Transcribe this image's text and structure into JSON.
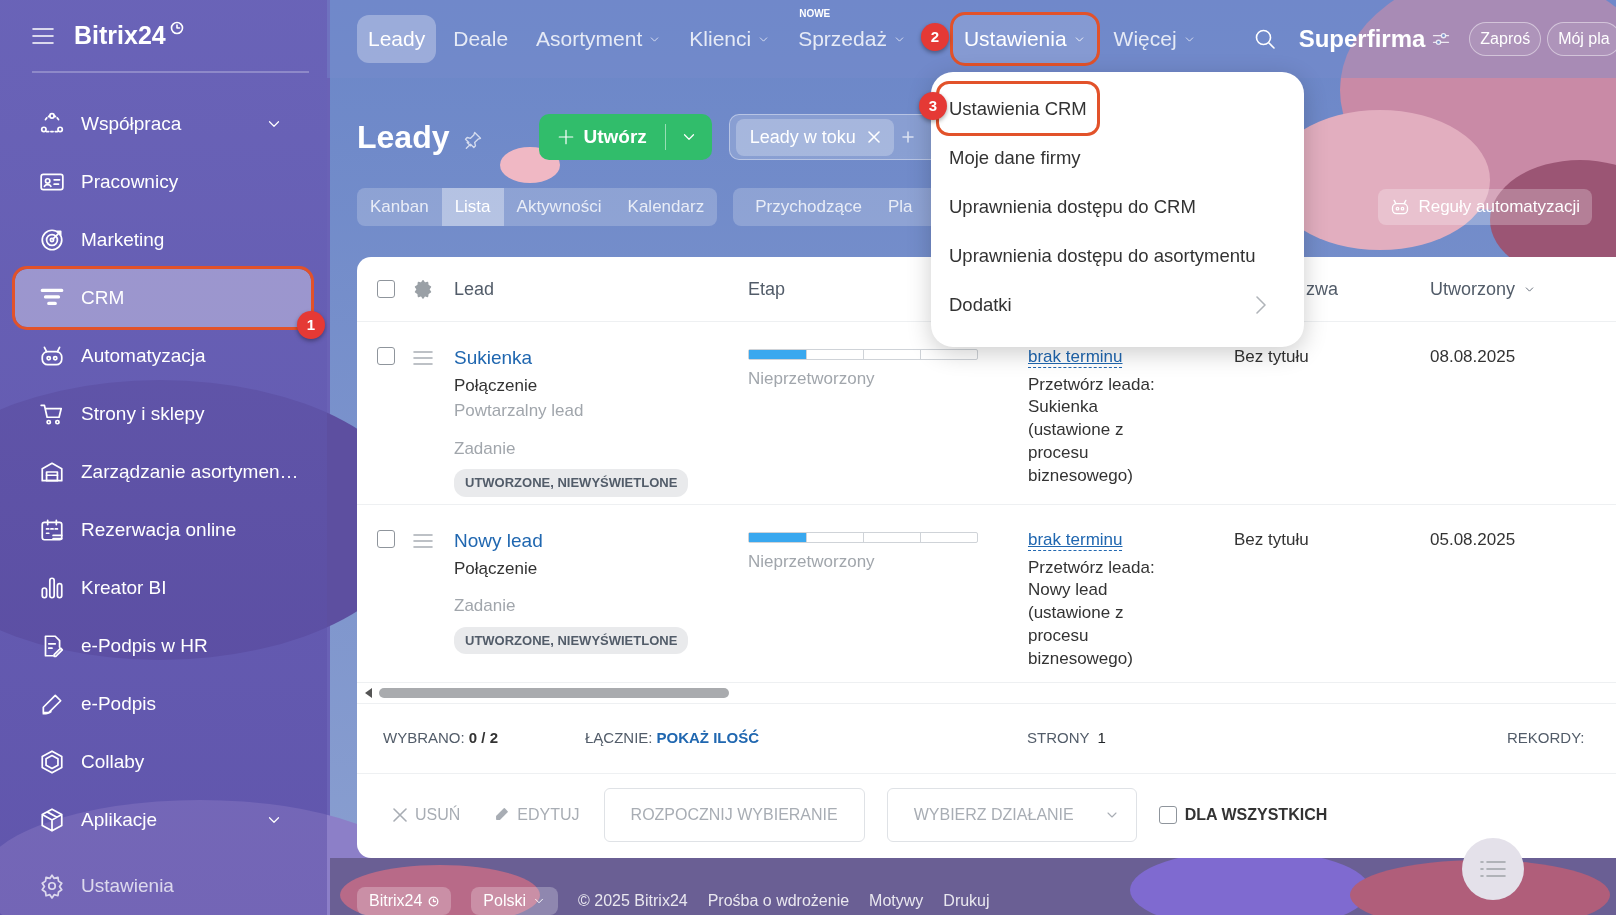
{
  "sidebar": {
    "logo": "Bitrix24",
    "items": [
      {
        "label": "Współpraca",
        "kind": "group",
        "selected": false
      },
      {
        "label": "Pracownicy",
        "kind": "link",
        "selected": false
      },
      {
        "label": "Marketing",
        "kind": "link",
        "selected": false
      },
      {
        "label": "CRM",
        "kind": "link",
        "selected": true,
        "callout": "1"
      },
      {
        "label": "Automatyzacja",
        "kind": "link",
        "selected": false
      },
      {
        "label": "Strony i sklepy",
        "kind": "link",
        "selected": false
      },
      {
        "label": "Zarządzanie asortymen…",
        "kind": "link",
        "selected": false
      },
      {
        "label": "Rezerwacja online",
        "kind": "link",
        "selected": false
      },
      {
        "label": "Kreator BI",
        "kind": "link",
        "selected": false
      },
      {
        "label": "e-Podpis w HR",
        "kind": "link",
        "selected": false
      },
      {
        "label": "e-Podpis",
        "kind": "link",
        "selected": false
      },
      {
        "label": "Collaby",
        "kind": "link",
        "selected": false
      },
      {
        "label": "Aplikacje",
        "kind": "group",
        "selected": false
      }
    ],
    "settings": "Ustawienia"
  },
  "top_nav": {
    "items": [
      {
        "label": "Leady",
        "kind": "link",
        "selected": true
      },
      {
        "label": "Deale",
        "kind": "link",
        "selected": false
      },
      {
        "label": "Asortyment",
        "kind": "menu",
        "selected": false
      },
      {
        "label": "Klienci",
        "kind": "menu",
        "selected": false
      },
      {
        "label": "Sprzedaż",
        "kind": "menu",
        "selected": false,
        "badge": "NOWE"
      },
      {
        "label": "Ustawienia",
        "kind": "menu",
        "selected": false,
        "callout": "2"
      },
      {
        "label": "Więcej",
        "kind": "menu",
        "selected": false
      }
    ],
    "company": "Superfirma",
    "buttons": [
      "Zaproś",
      "Mój pla"
    ]
  },
  "dropdown": {
    "items": [
      {
        "label": "Ustawienia CRM",
        "kind": "link",
        "callout": "3"
      },
      {
        "label": "Moje dane firmy",
        "kind": "link"
      },
      {
        "label": "Uprawnienia dostępu do CRM",
        "kind": "link"
      },
      {
        "label": "Uprawnienia dostępu do asortymentu",
        "kind": "link"
      },
      {
        "label": "Dodatki",
        "kind": "submenu"
      }
    ]
  },
  "page": {
    "title": "Leady",
    "create_button": "Utwórz",
    "filter_chip": "Leady w toku",
    "views": [
      {
        "label": "Kanban",
        "selected": false
      },
      {
        "label": "Lista",
        "selected": true
      },
      {
        "label": "Aktywności",
        "selected": false
      },
      {
        "label": "Kalendarz",
        "selected": false
      }
    ],
    "lists": [
      "Przychodzące",
      "Pla"
    ],
    "automation_button": "Reguły automatyzacji"
  },
  "table": {
    "select_all_checked": false,
    "columns": [
      {
        "label": "Lead",
        "sorted": false
      },
      {
        "label": "Etap",
        "sorted": false
      },
      {
        "label": "zwa",
        "sorted": false
      },
      {
        "label": "Utworzony",
        "sorted": true
      }
    ],
    "rows": [
      {
        "checked": false,
        "title": "Sukienka",
        "source": "Połączenie",
        "note": "Powtarzalny lead",
        "activity_type": "Zadanie",
        "status": "UTWORZONE, NIEWYŚWIETLONE",
        "stage": {
          "level": 0.25,
          "label": "Nieprzetworzony"
        },
        "deadline": "brak terminu",
        "activity": "Przetwórz leada: Sukienka (ustawione z procesu biznesowego)",
        "name": "Bez tytułu",
        "created": "08.08.2025"
      },
      {
        "checked": false,
        "title": "Nowy lead",
        "source": "Połączenie",
        "activity_type": "Zadanie",
        "status": "UTWORZONE, NIEWYŚWIETLONE",
        "stage": {
          "level": 0.25,
          "label": "Nieprzetworzony"
        },
        "deadline": "brak terminu",
        "activity": "Przetwórz leada: Nowy lead (ustawione z procesu biznesowego)",
        "name": "Bez tytułu",
        "created": "05.08.2025"
      }
    ]
  },
  "summary": {
    "selected": "WYBRANO: **0 / 2**",
    "total_label": "ŁĄCZNIE:",
    "total_link": "POKAŻ ILOŚĆ",
    "pages_label": "STRONY",
    "pages": "1",
    "records_label": "REKORDY:"
  },
  "actions": [
    {
      "label": "USUŃ",
      "kind": "icon-delete",
      "disabled": true
    },
    {
      "label": "EDYTUJ",
      "kind": "icon-edit",
      "disabled": true
    },
    {
      "label": "ROZPOCZNIJ WYBIERANIE",
      "kind": "button",
      "disabled": true
    },
    {
      "label": "WYBIERZ DZIAŁANIE",
      "kind": "select",
      "disabled": true
    },
    {
      "label": "DLA WSZYSTKICH",
      "kind": "checkbox",
      "checked": false,
      "disabled": false
    }
  ],
  "footer": {
    "logo": "Bitrix24",
    "language": "Polski",
    "links": [
      "© 2025 Bitrix24",
      "Prośba o wdrożenie",
      "Motywy",
      "Drukuj"
    ]
  }
}
